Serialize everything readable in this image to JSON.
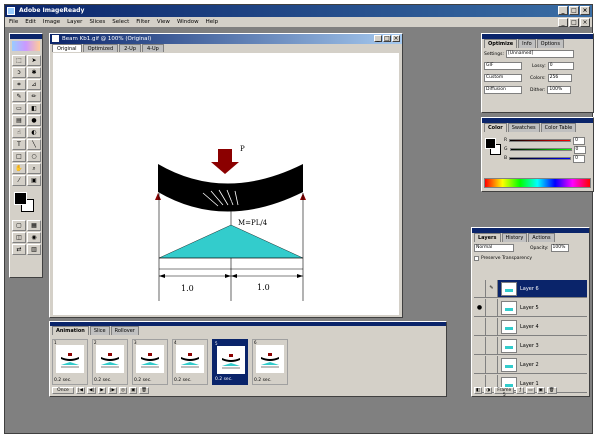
{
  "app": {
    "title": "Adobe ImageReady"
  },
  "menu": [
    "File",
    "Edit",
    "Image",
    "Layer",
    "Slices",
    "Select",
    "Filter",
    "View",
    "Window",
    "Help"
  ],
  "document": {
    "title": "Beam Kb1.gif @ 100% (Original)",
    "tabs": [
      "Original",
      "Optimized",
      "2-Up",
      "4-Up"
    ]
  },
  "drawing": {
    "load_label": "P",
    "moment_label": "M=PL/4",
    "dim_left": "1.0",
    "dim_right": "1.0",
    "fill_color": "#33cccc",
    "load_color": "#8b0000"
  },
  "animation": {
    "tabs": [
      "Animation",
      "Slice",
      "Rollover"
    ],
    "frames": [
      {
        "num": "1",
        "delay": "0.2 sec."
      },
      {
        "num": "2",
        "delay": "0.2 sec."
      },
      {
        "num": "3",
        "delay": "0.2 sec."
      },
      {
        "num": "4",
        "delay": "0.2 sec."
      },
      {
        "num": "5",
        "delay": "0.2 sec.",
        "selected": true
      },
      {
        "num": "6",
        "delay": "0.2 sec."
      }
    ],
    "loop_label": "Once"
  },
  "optimize": {
    "tabs": [
      "Optimize",
      "Info",
      "Options"
    ],
    "settings_label": "Settings:",
    "settings_value": "[Unnamed]",
    "format": "GIF",
    "lossy_label": "Lossy:",
    "lossy_value": "0",
    "palette": "Custom",
    "colors_label": "Colors:",
    "colors_value": "256",
    "dither": "Diffusion",
    "dither_label": "Dither:",
    "dither_value": "100%"
  },
  "colorpanel": {
    "tabs": [
      "Color",
      "Swatches",
      "Color Table"
    ],
    "r": "0",
    "g": "0",
    "b": "0"
  },
  "layers": {
    "tabs": [
      "Layers",
      "History",
      "Actions"
    ],
    "mode": "Normal",
    "opacity_label": "Opacity:",
    "opacity_value": "100%",
    "preserve_label": "Preserve Transparency",
    "items": [
      {
        "name": "Layer 6",
        "selected": true
      },
      {
        "name": "Layer 5"
      },
      {
        "name": "Layer 4"
      },
      {
        "name": "Layer 3"
      },
      {
        "name": "Layer 2"
      },
      {
        "name": "Layer 1"
      }
    ],
    "frame_label": "Frame 5"
  }
}
